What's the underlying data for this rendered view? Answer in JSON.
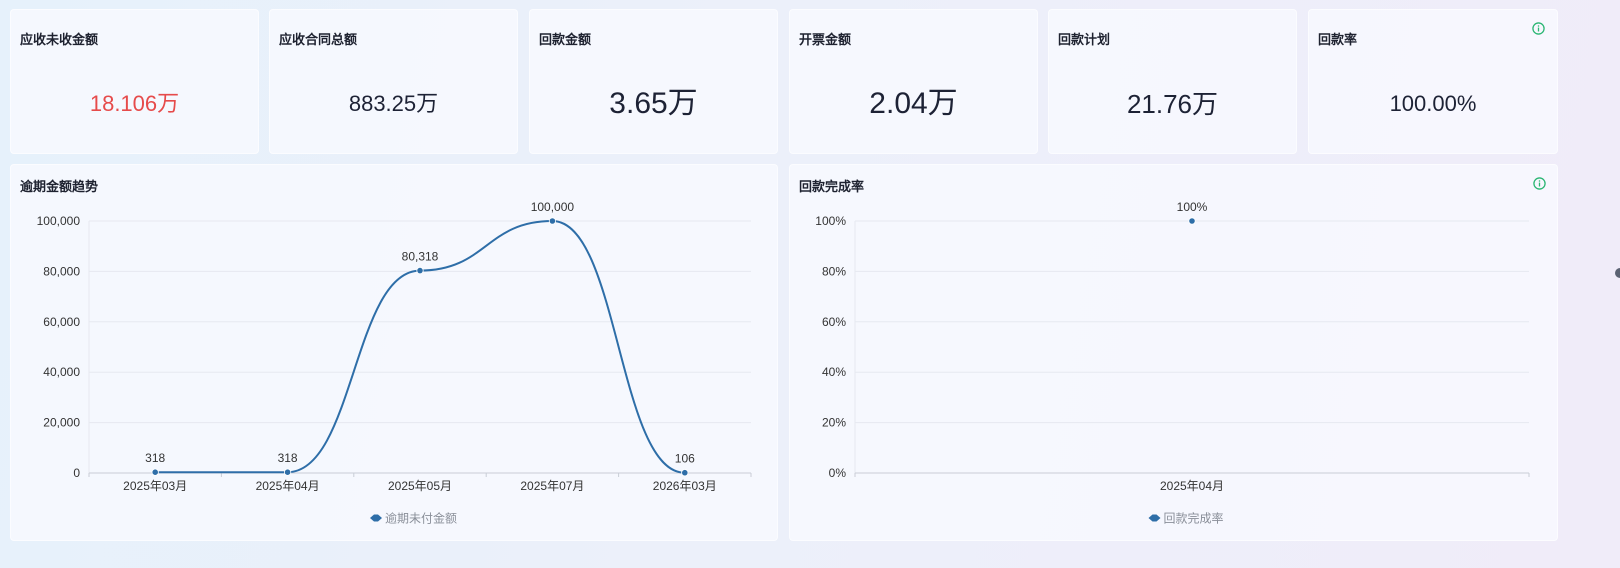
{
  "kpis": [
    {
      "title": "应收未收金额",
      "value": "18.106万",
      "color": "#e64b4b",
      "size": 22
    },
    {
      "title": "应收合同总额",
      "value": "883.25万",
      "color": "#1d2235",
      "size": 22
    },
    {
      "title": "回款金额",
      "value": "3.65万",
      "color": "#1d2235",
      "size": 30
    },
    {
      "title": "开票金额",
      "value": "2.04万",
      "color": "#1d2235",
      "size": 30
    },
    {
      "title": "回款计划",
      "value": "21.76万",
      "color": "#1d2235",
      "size": 26
    },
    {
      "title": "回款率",
      "value": "100.00%",
      "color": "#1d2235",
      "size": 22,
      "info_icon": "info-icon"
    }
  ],
  "panels": {
    "overdue": {
      "title": "逾期金额趋势"
    },
    "completion": {
      "title": "回款完成率",
      "info_icon": "info-icon"
    }
  },
  "chart_data": [
    {
      "type": "line",
      "title": "逾期金额趋势",
      "categories": [
        "2025年03月",
        "2025年04月",
        "2025年05月",
        "2025年07月",
        "2026年03月"
      ],
      "series": [
        {
          "name": "逾期未付金额",
          "values": [
            318,
            318,
            80318,
            100000,
            106
          ],
          "color": "#2e6ea8"
        }
      ],
      "data_labels": [
        "318",
        "318",
        "80,318",
        "100,000",
        "106"
      ],
      "yticks": [
        "0",
        "20,000",
        "40,000",
        "60,000",
        "80,000",
        "100,000"
      ],
      "ylim": [
        0,
        100000
      ],
      "grid": true,
      "smooth": true,
      "legend": "bottom-center"
    },
    {
      "type": "scatter",
      "title": "回款完成率",
      "categories": [
        "2025年04月"
      ],
      "series": [
        {
          "name": "回款完成率",
          "values": [
            100
          ],
          "color": "#2e6ea8"
        }
      ],
      "data_labels": [
        "100%"
      ],
      "yticks": [
        "0%",
        "20%",
        "40%",
        "60%",
        "80%",
        "100%"
      ],
      "ylim": [
        0,
        100
      ],
      "grid": true,
      "legend": "bottom-center"
    }
  ]
}
